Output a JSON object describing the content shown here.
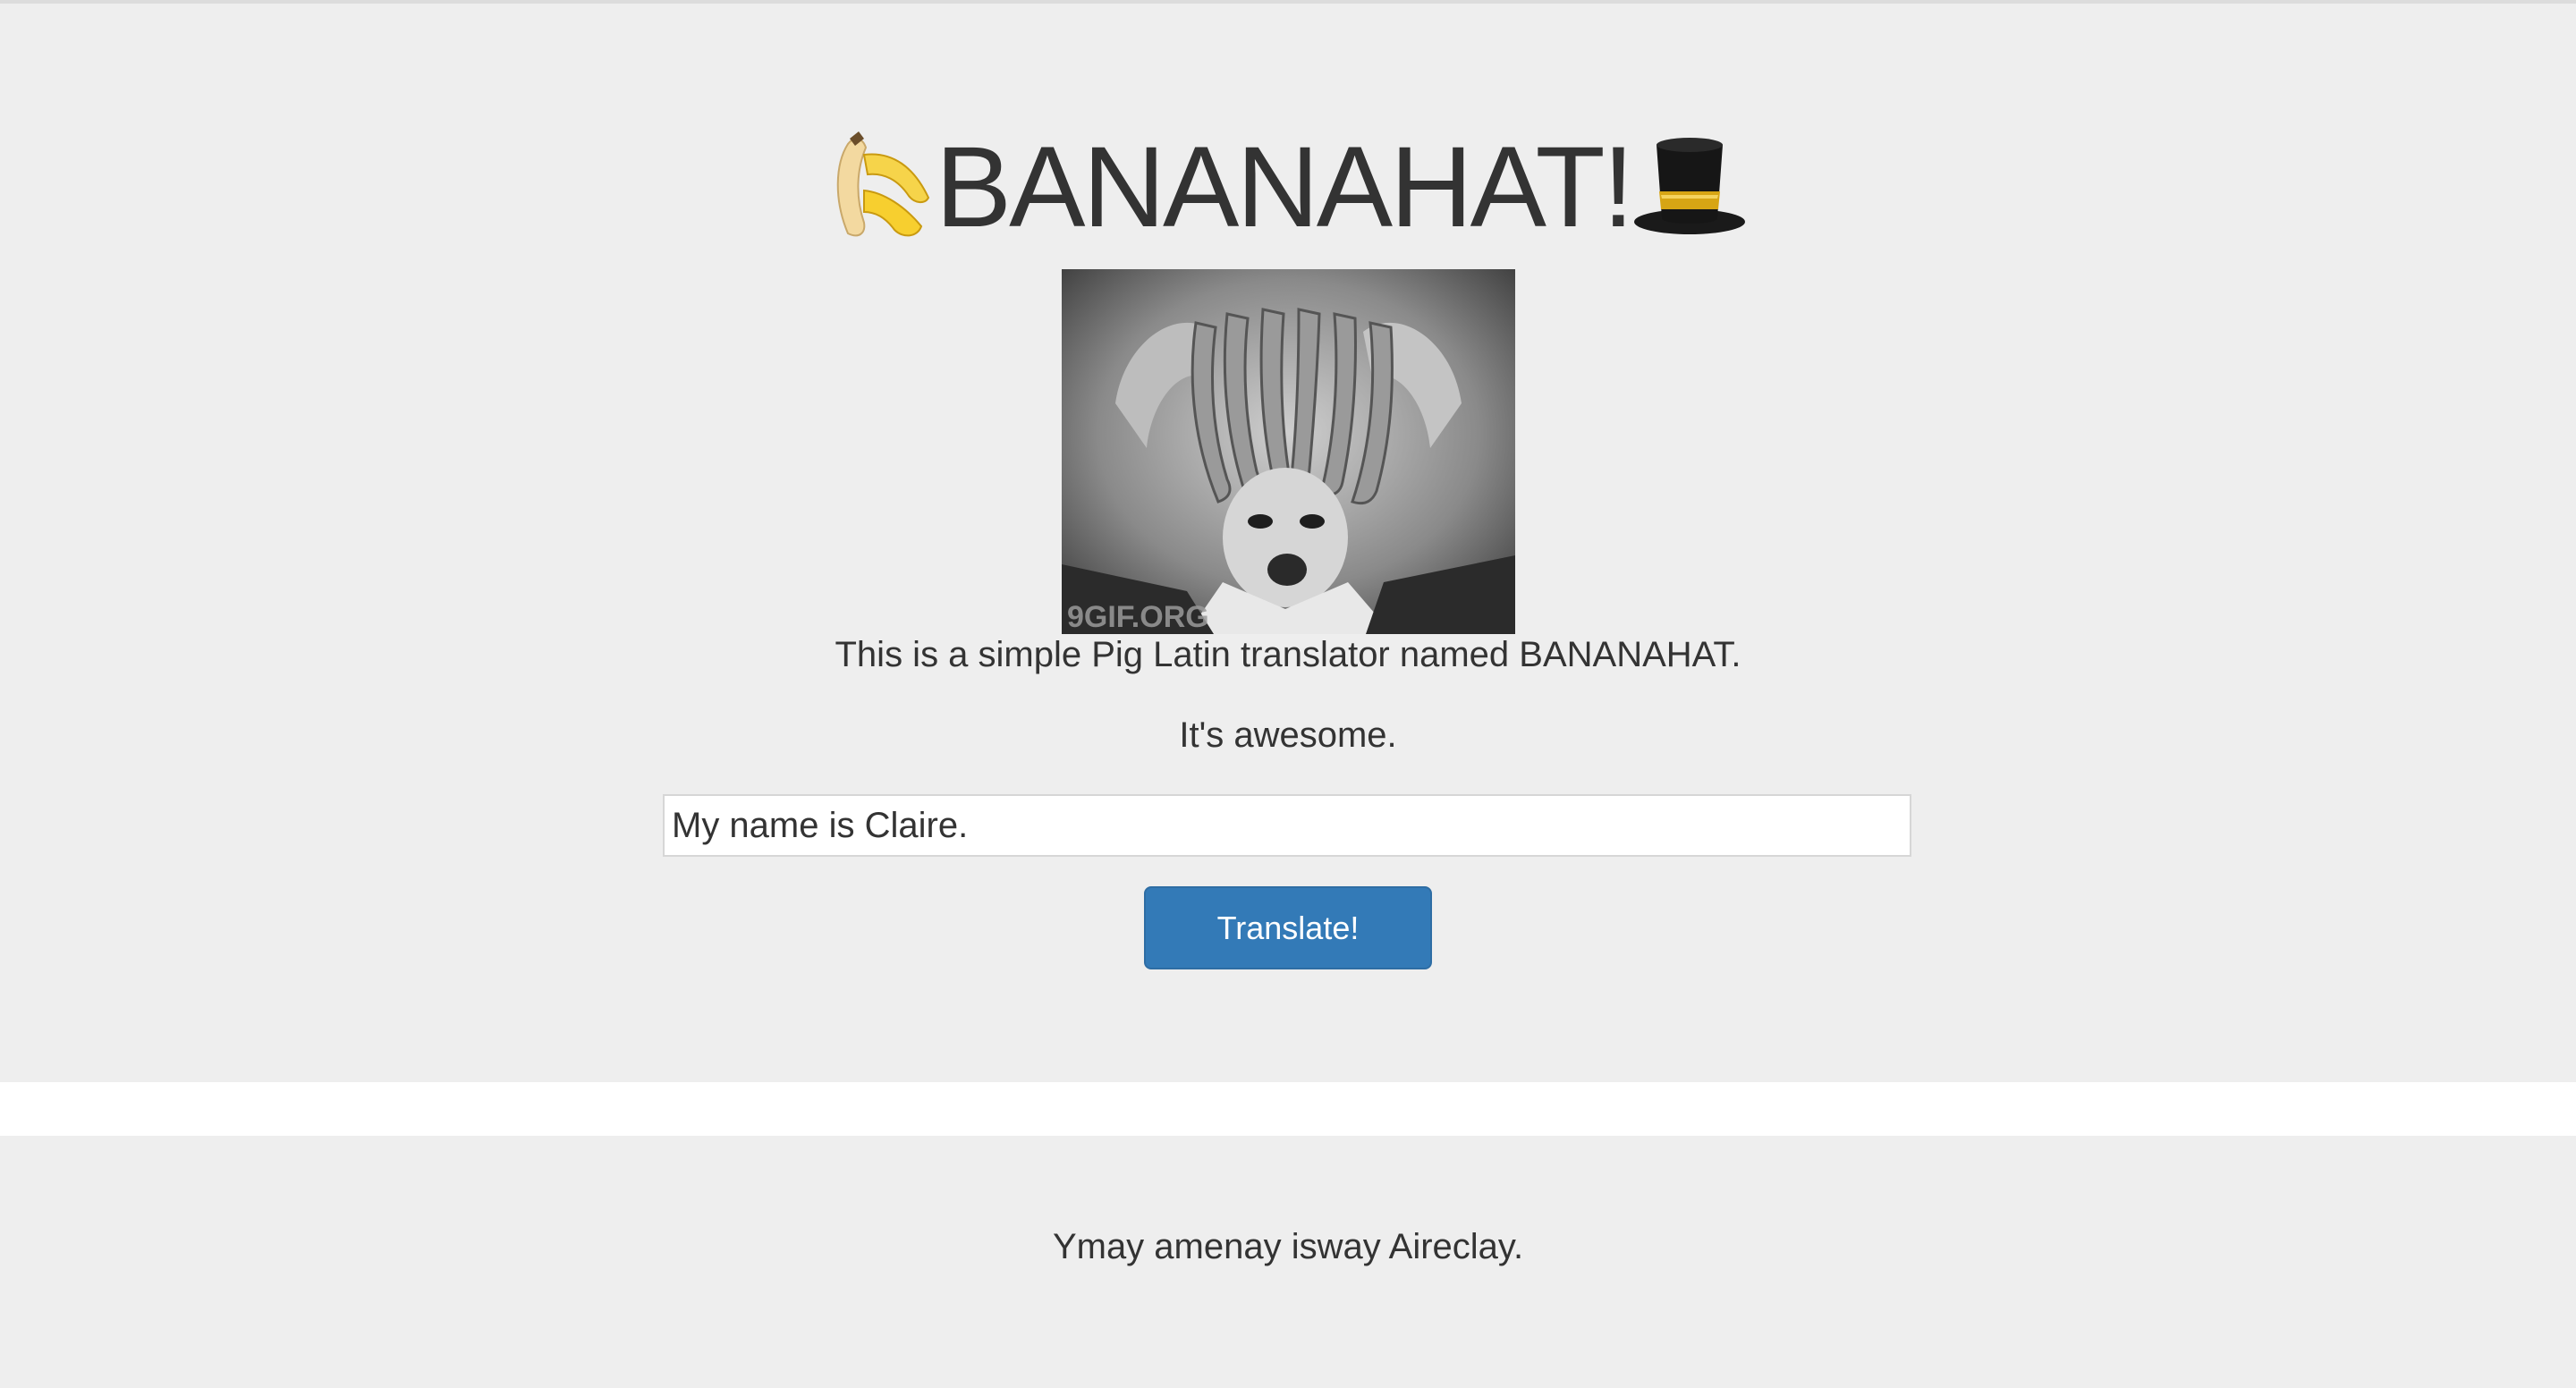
{
  "header": {
    "title": "BANANAHAT!",
    "left_emoji": "banana-icon",
    "right_emoji": "top-hat-icon"
  },
  "hero_image": {
    "watermark": "9GIF.ORG"
  },
  "intro": {
    "description": "This is a simple Pig Latin translator named BANANAHAT.",
    "tagline": "It's awesome."
  },
  "form": {
    "input_value": "My name is Claire.",
    "button_label": "Translate!"
  },
  "result": {
    "text": "Ymay amenay isway Aireclay."
  },
  "colors": {
    "background": "#eeeeee",
    "button": "#337ab7",
    "text": "#333333"
  }
}
